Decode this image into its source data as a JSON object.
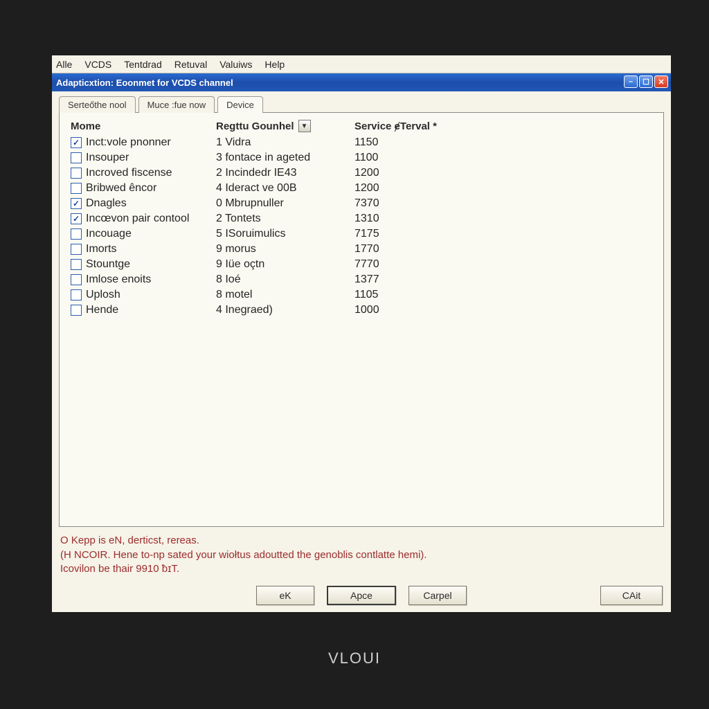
{
  "menu": {
    "items": [
      "Alle",
      "VCDS",
      "Tentdrad",
      "Retuval",
      "Valuiws",
      "Help"
    ]
  },
  "titlebar": {
    "text": "Adapticxtion: Eoonmet for VCDS channel"
  },
  "tabs": [
    {
      "label": "Serteőthe nool"
    },
    {
      "label": "Muce :fue now"
    },
    {
      "label": "Device"
    }
  ],
  "columns": {
    "name": "Mome",
    "channel": "Regttu Gounhel",
    "service": "Service ɇTerval *"
  },
  "rows": [
    {
      "checked": true,
      "name": "Inct:vole pnonner",
      "channel": "1 Vidra",
      "service": "1150"
    },
    {
      "checked": false,
      "name": "Insouper",
      "channel": "3 fontace in ageted",
      "service": "1100"
    },
    {
      "checked": false,
      "name": "Incroved fiscense",
      "channel": "2 Incindedr IE43",
      "service": "1200"
    },
    {
      "checked": false,
      "name": "Bribwed êncor",
      "channel": "4 Ideract ve 00B",
      "service": "1200"
    },
    {
      "checked": true,
      "name": "Dnagles",
      "channel": "0 Mbrupnuller",
      "service": "7370"
    },
    {
      "checked": true,
      "name": "Incœvon pair contool",
      "channel": "2 Tontets",
      "service": "1310"
    },
    {
      "checked": false,
      "name": "Incouage",
      "channel": "5 ISoruimulics",
      "service": "7175"
    },
    {
      "checked": false,
      "name": "Imorts",
      "channel": "9 morus",
      "service": "1770"
    },
    {
      "checked": false,
      "name": "Stountge",
      "channel": "9 Iüe oçtn",
      "service": "7770"
    },
    {
      "checked": false,
      "name": "Imlose enoits",
      "channel": "8 Ioé",
      "service": "1377"
    },
    {
      "checked": false,
      "name": "Uplosh",
      "channel": "8 motel",
      "service": "1105"
    },
    {
      "checked": false,
      "name": "Hende",
      "channel": "4 Inegraed)",
      "service": "1000"
    }
  ],
  "status": {
    "line1": "O Kepp is eN, derticst, rereas.",
    "line2": "(H  NCOIR. Hene to-np sated your wiołtus adoutted the genoblis contlatte hemi).",
    "line3": "Icovilon be thair 9910 ƀɪT."
  },
  "buttons": {
    "ok": "eK",
    "apply": "Apce",
    "cancel": "Carpel",
    "cait": "CAit"
  },
  "brand": "VLOUI"
}
